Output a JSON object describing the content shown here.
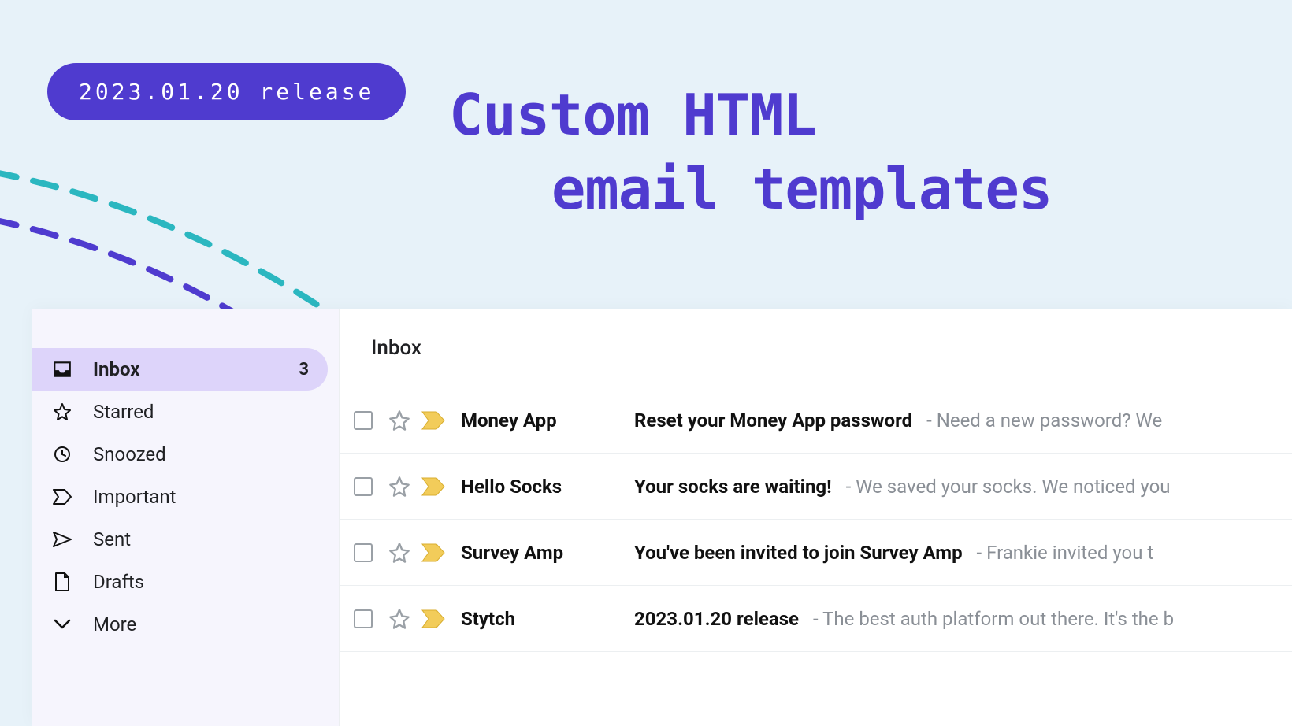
{
  "badge": {
    "text": "2023.01.20 release"
  },
  "headline": {
    "line1": "Custom HTML",
    "line2": "email templates"
  },
  "colors": {
    "accent": "#4f3bcf",
    "teal": "#2bb7c0",
    "sidebar_active_bg": "#ddd4fa",
    "star_fill": "#f2cc5a"
  },
  "sidebar": {
    "items": [
      {
        "icon": "inbox",
        "label": "Inbox",
        "count": "3",
        "active": true
      },
      {
        "icon": "star",
        "label": "Starred"
      },
      {
        "icon": "clock",
        "label": "Snoozed"
      },
      {
        "icon": "important",
        "label": "Important"
      },
      {
        "icon": "send",
        "label": "Sent"
      },
      {
        "icon": "draft",
        "label": "Drafts"
      },
      {
        "icon": "chevron",
        "label": "More"
      }
    ]
  },
  "main": {
    "header": "Inbox",
    "emails": [
      {
        "sender": "Money App",
        "subject": "Reset your Money App password",
        "preview": "Need a new password? We"
      },
      {
        "sender": "Hello Socks",
        "subject": "Your socks are waiting!",
        "preview": "We saved your socks. We noticed you"
      },
      {
        "sender": "Survey Amp",
        "subject": "You've been invited to join Survey Amp",
        "preview": "Frankie invited you t"
      },
      {
        "sender": "Stytch",
        "subject": "2023.01.20 release",
        "preview": "The best auth platform out there. It's the b"
      }
    ]
  }
}
